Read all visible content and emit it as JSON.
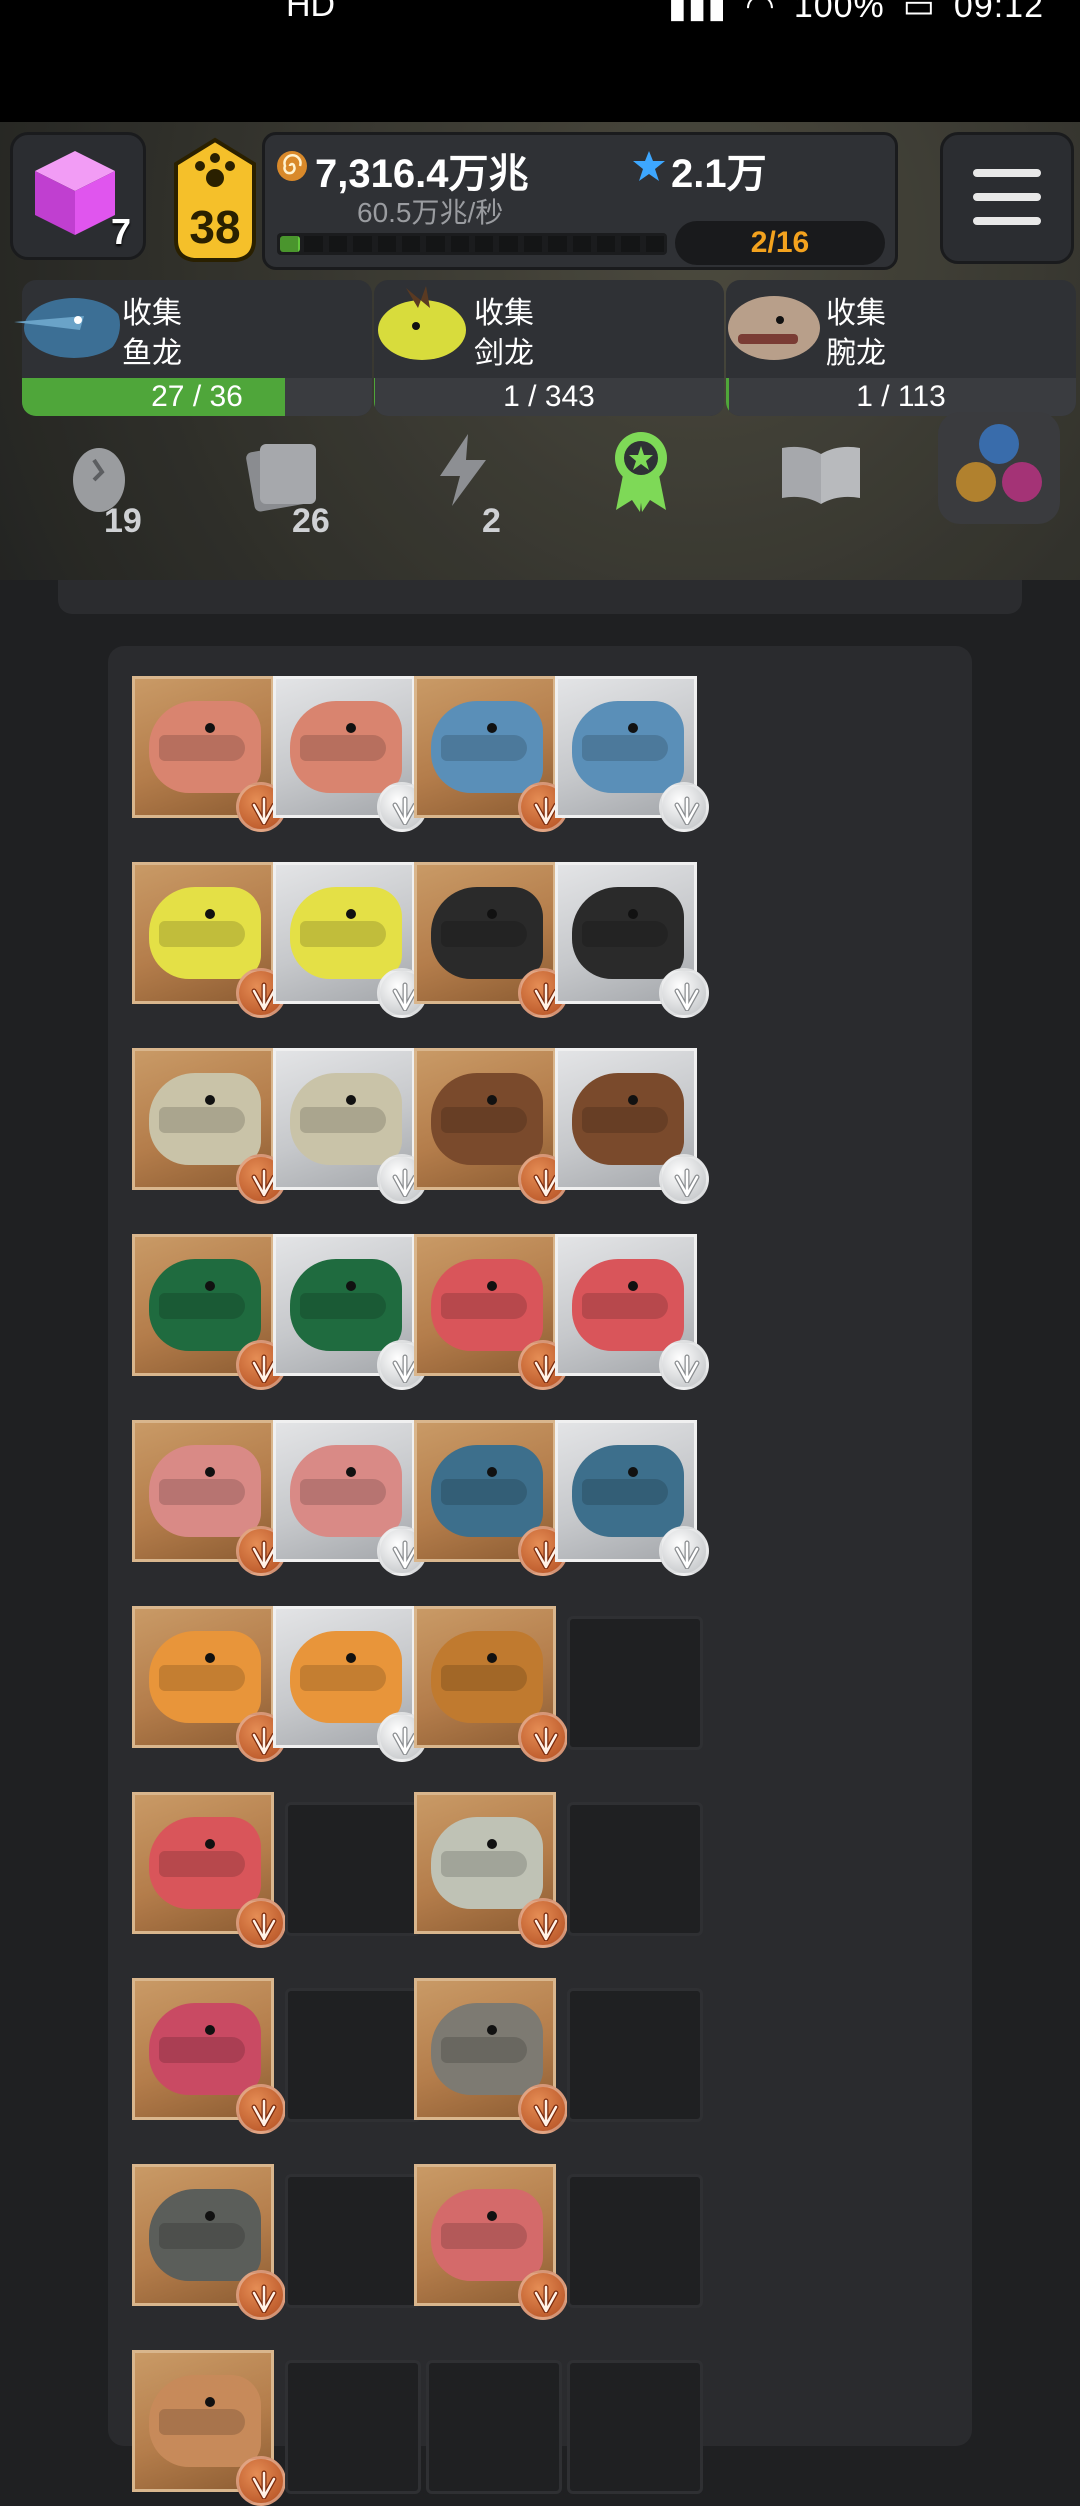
{
  "status_bar": {
    "left_text": "HD",
    "right_text": "100%",
    "time": "09:12"
  },
  "hud": {
    "cube_count": "7",
    "player_level": "38",
    "money": "7,316.4万兆",
    "income_rate": "60.5万兆/秒",
    "gems": "2.1万",
    "stage": "2/16",
    "progress_fraction": 0.05
  },
  "goals": [
    {
      "title": "收集",
      "name": "鱼龙",
      "progress_text": "27 / 36",
      "progress": 0.75,
      "avatar_color": "#4b7fa8"
    },
    {
      "title": "收集",
      "name": "剑龙",
      "progress_text": "1 / 343",
      "progress": 0.003,
      "avatar_color": "#d8dc3c"
    },
    {
      "title": "收集",
      "name": "腕龙",
      "progress_text": "1 / 113",
      "progress": 0.009,
      "avatar_color": "#b89f8a"
    }
  ],
  "tabs": [
    {
      "icon": "egg-icon",
      "count": "19"
    },
    {
      "icon": "cards-icon",
      "count": "26"
    },
    {
      "icon": "lightning-icon",
      "count": "2"
    },
    {
      "icon": "ribbon-award-icon",
      "count": ""
    },
    {
      "icon": "book-icon",
      "count": ""
    },
    {
      "icon": "teams-icon",
      "count": ""
    }
  ],
  "grid": {
    "columns": 4,
    "rows": [
      [
        {
          "tier": "bronze",
          "color": "#d9846f"
        },
        {
          "tier": "silver",
          "color": "#d9846f"
        },
        {
          "tier": "bronze",
          "color": "#5a8fb8"
        },
        {
          "tier": "silver",
          "color": "#5a8fb8"
        }
      ],
      [
        {
          "tier": "bronze",
          "color": "#e4e046"
        },
        {
          "tier": "silver",
          "color": "#e4e046"
        },
        {
          "tier": "bronze",
          "color": "#2a2a2a"
        },
        {
          "tier": "silver",
          "color": "#2a2a2a"
        }
      ],
      [
        {
          "tier": "bronze",
          "color": "#c9c3a8"
        },
        {
          "tier": "silver",
          "color": "#c9c3a8"
        },
        {
          "tier": "bronze",
          "color": "#7a4a2c"
        },
        {
          "tier": "silver",
          "color": "#7a4a2c"
        }
      ],
      [
        {
          "tier": "bronze",
          "color": "#1f6b3f"
        },
        {
          "tier": "silver",
          "color": "#1f6b3f"
        },
        {
          "tier": "bronze",
          "color": "#d9555a"
        },
        {
          "tier": "silver",
          "color": "#d9555a"
        }
      ],
      [
        {
          "tier": "bronze",
          "color": "#d98a86"
        },
        {
          "tier": "silver",
          "color": "#d98a86"
        },
        {
          "tier": "bronze",
          "color": "#3d6f8c"
        },
        {
          "tier": "silver",
          "color": "#3d6f8c"
        }
      ],
      [
        {
          "tier": "bronze",
          "color": "#e8953a"
        },
        {
          "tier": "silver",
          "color": "#e8953a"
        },
        {
          "tier": "bronze",
          "color": "#c07a2f"
        },
        {
          "tier": "empty"
        }
      ],
      [
        {
          "tier": "bronze",
          "color": "#d9555a"
        },
        {
          "tier": "empty"
        },
        {
          "tier": "bronze",
          "color": "#bfc2b5"
        },
        {
          "tier": "empty"
        }
      ],
      [
        {
          "tier": "bronze",
          "color": "#c94a63"
        },
        {
          "tier": "empty"
        },
        {
          "tier": "bronze",
          "color": "#7d7a72"
        },
        {
          "tier": "empty"
        }
      ],
      [
        {
          "tier": "bronze",
          "color": "#5b5e5a"
        },
        {
          "tier": "empty"
        },
        {
          "tier": "bronze",
          "color": "#d46a6a"
        },
        {
          "tier": "empty"
        }
      ],
      [
        {
          "tier": "bronze",
          "color": "#c78a5a"
        },
        {
          "tier": "empty"
        },
        {
          "tier": "empty"
        },
        {
          "tier": "empty"
        }
      ]
    ]
  }
}
